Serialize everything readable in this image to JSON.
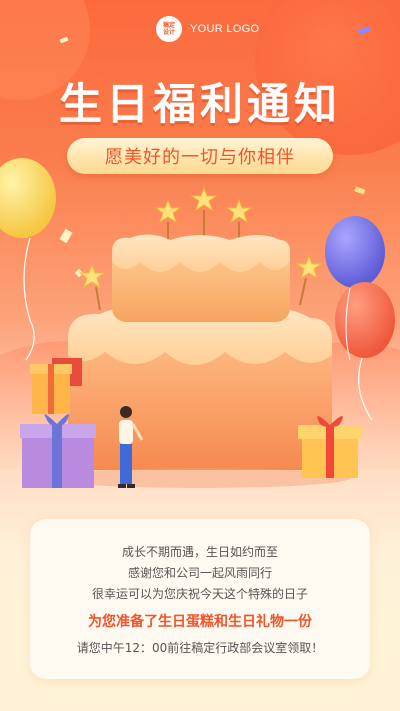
{
  "logo": {
    "badge_text": "稿定\n设计",
    "text": "YOUR LOGO"
  },
  "poster": {
    "title": "生日福利通知",
    "subtitle": "愿美好的一切与你相伴"
  },
  "card": {
    "line1": "成长不期而遇，生日如约而至",
    "line2": "感谢您和公司一起风雨同行",
    "line3": "很幸运可以为您庆祝今天这个特殊的日子",
    "highlight": "为您准备了生日蛋糕和生日礼物一份",
    "line5": "请您中午12：00前往稿定行政部会议室领取！"
  },
  "colors": {
    "accent": "#f0542a",
    "background_top": "#fb6a3d",
    "background_bottom": "#fff3d4",
    "cake": "#fba66d"
  }
}
